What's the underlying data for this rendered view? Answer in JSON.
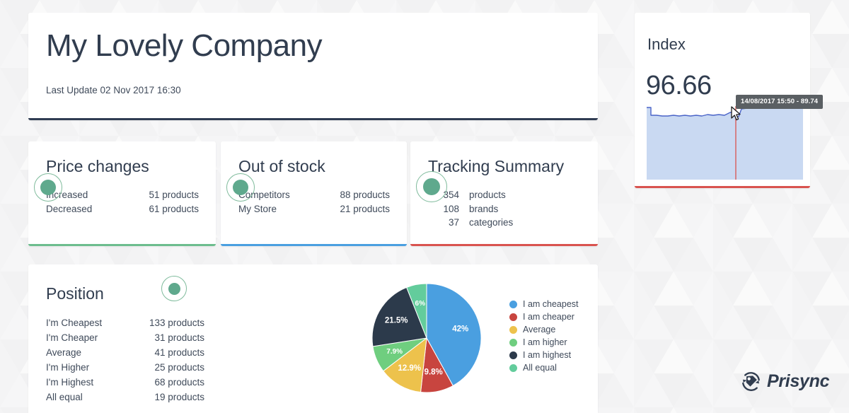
{
  "header": {
    "company_title": "My Lovely Company",
    "last_update": "Last Update 02 Nov 2017 16:30",
    "accent_color": "#2f3c52"
  },
  "price_changes": {
    "title": "Price changes",
    "accent_color": "#6dbd8e",
    "badge_icon": "status-dot-icon",
    "rows": [
      {
        "label": "Increased",
        "value": "51 products"
      },
      {
        "label": "Decreased",
        "value": "61 products"
      }
    ]
  },
  "out_of_stock": {
    "title": "Out of stock",
    "accent_color": "#4a9fe0",
    "badge_icon": "status-dot-icon",
    "rows": [
      {
        "label": "Competitors",
        "value": "88 products"
      },
      {
        "label": "My Store",
        "value": "21 products"
      }
    ]
  },
  "tracking_summary": {
    "title": "Tracking Summary",
    "accent_color": "#d9534f",
    "badge_icon": "status-dot-icon",
    "rows": [
      {
        "num": "354",
        "noun": "products"
      },
      {
        "num": "108",
        "noun": "brands"
      },
      {
        "num": "37",
        "noun": "categories"
      }
    ]
  },
  "position": {
    "title": "Position",
    "badge_icon": "status-dot-icon",
    "rows": [
      {
        "label": "I'm Cheapest",
        "value": "133 products"
      },
      {
        "label": "I'm Cheaper",
        "value": "31 products"
      },
      {
        "label": "Average",
        "value": "41 products"
      },
      {
        "label": "I'm Higher",
        "value": "25 products"
      },
      {
        "label": "I'm Highest",
        "value": "68 products"
      },
      {
        "label": "All equal",
        "value": "19 products"
      }
    ]
  },
  "index": {
    "title": "Index",
    "value": "96.66",
    "accent_color": "#d9534f",
    "tooltip": "14/08/2017 15:50 - 89.74",
    "cursor_icon": "mouse-pointer-icon",
    "crosshair_color": "#d9534f",
    "area_fill": "#c9d9f2",
    "line_color": "#4a64c8"
  },
  "brand": {
    "name": "Prisync",
    "logo_icon": "prisync-sync-tag-icon",
    "color": "#313d4f"
  },
  "chart_data": {
    "type": "pie",
    "title": "",
    "legend_position": "right",
    "categories": [
      "I am cheapest",
      "I am cheaper",
      "Average",
      "I am higher",
      "I am highest",
      "All equal"
    ],
    "values": [
      42,
      9.8,
      12.9,
      7.9,
      21.5,
      6
    ],
    "labels": [
      "42%",
      "9.8%",
      "12.9%",
      "7.9%",
      "21.5%",
      "6%"
    ],
    "colors": [
      "#4a9fe0",
      "#c8453f",
      "#edc24c",
      "#6fce7f",
      "#2c3a4b",
      "#63cc9c"
    ],
    "legend": [
      {
        "label": "I am cheapest",
        "color": "#4a9fe0"
      },
      {
        "label": "I am cheaper",
        "color": "#c8453f"
      },
      {
        "label": "Average",
        "color": "#edc24c"
      },
      {
        "label": "I am higher",
        "color": "#6fce7f"
      },
      {
        "label": "I am highest",
        "color": "#2c3a4b"
      },
      {
        "label": "All equal",
        "color": "#63cc9c"
      }
    ]
  }
}
